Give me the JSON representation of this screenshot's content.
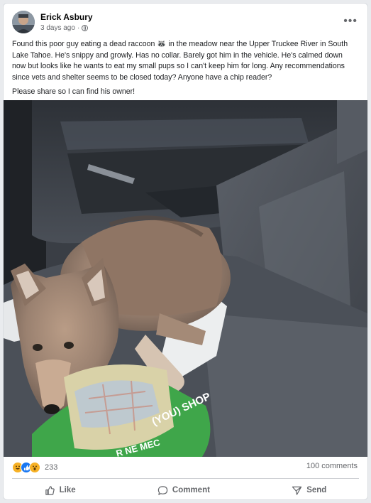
{
  "post": {
    "author": "Erick Asbury",
    "timestamp": "3 days ago",
    "body_paragraphs": [
      "Found this poor guy eating a dead raccoon 🦝 in the meadow near the Upper Truckee River in South Lake Tahoe. He's snippy and growly. Has no collar. Barely got him in the vehicle. He's calmed down now but looks like he wants to eat my small pups so I can't keep him for long. Any recommendations since vets and shelter seems to be closed today? Anyone have a chip reader?",
      "Please share so I can find his owner!"
    ],
    "photo_bag_text": "(YOU) SHOP",
    "photo_bag_text2": "R NE MEC"
  },
  "stats": {
    "reaction_count": "233",
    "comments_label": "100 comments",
    "reaction_icons": [
      "haha-icon",
      "like-icon",
      "wow-icon"
    ]
  },
  "actions": {
    "like_label": "Like",
    "comment_label": "Comment",
    "send_label": "Send"
  },
  "colors": {
    "like_blue": "#1877f2",
    "reaction_yellow": "#f7b125",
    "secondary_text": "#65676b"
  }
}
